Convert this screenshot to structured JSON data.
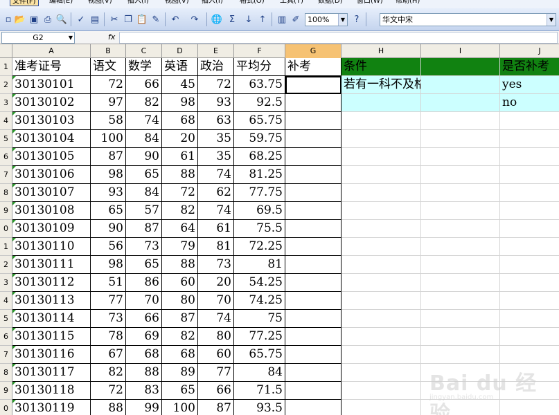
{
  "menu": {
    "items": [
      {
        "label": "文件(F)",
        "active": true
      },
      {
        "label": "编辑(E)"
      },
      {
        "label": "视图(V)"
      },
      {
        "label": "插入(I)"
      },
      {
        "label": "视图(V)"
      },
      {
        "label": "插入(I)"
      },
      {
        "label": "格式(O)"
      },
      {
        "label": "工具(T)"
      },
      {
        "label": "数据(D)"
      },
      {
        "label": "窗口(W)"
      },
      {
        "label": "帮助(H)"
      }
    ]
  },
  "toolbar": {
    "zoom_value": "100%",
    "font_value": "华文中宋",
    "icons": [
      "new-icon",
      "open-icon",
      "save-icon",
      "print-icon",
      "print-preview-icon",
      "spellcheck-icon",
      "research-icon",
      "cut-icon",
      "copy-icon",
      "paste-icon",
      "format-painter-icon",
      "undo-icon",
      "redo-icon",
      "hyperlink-icon",
      "autosum-icon",
      "sort-ascending-icon",
      "sort-descending-icon",
      "chart-icon",
      "drawing-icon",
      "help-icon"
    ]
  },
  "formula_bar": {
    "name_box": "G2",
    "fx_label": "fx",
    "formula": ""
  },
  "columns": [
    "A",
    "B",
    "C",
    "D",
    "E",
    "F",
    "G",
    "H",
    "I",
    "J"
  ],
  "selected_column": "G",
  "table": {
    "headers": [
      "准考证号",
      "语文",
      "数学",
      "英语",
      "政治",
      "平均分",
      "补考"
    ],
    "rows": [
      [
        "30130101",
        "72",
        "66",
        "45",
        "72",
        "63.75",
        ""
      ],
      [
        "30130102",
        "97",
        "82",
        "98",
        "93",
        "92.5",
        ""
      ],
      [
        "30130103",
        "58",
        "74",
        "68",
        "63",
        "65.75",
        ""
      ],
      [
        "30130104",
        "100",
        "84",
        "20",
        "35",
        "59.75",
        ""
      ],
      [
        "30130105",
        "87",
        "90",
        "61",
        "35",
        "68.25",
        ""
      ],
      [
        "30130106",
        "98",
        "65",
        "88",
        "74",
        "81.25",
        ""
      ],
      [
        "30130107",
        "93",
        "84",
        "72",
        "62",
        "77.75",
        ""
      ],
      [
        "30130108",
        "65",
        "57",
        "82",
        "74",
        "69.5",
        ""
      ],
      [
        "30130109",
        "90",
        "87",
        "64",
        "61",
        "75.5",
        ""
      ],
      [
        "30130110",
        "56",
        "73",
        "79",
        "81",
        "72.25",
        ""
      ],
      [
        "30130111",
        "98",
        "65",
        "88",
        "73",
        "81",
        ""
      ],
      [
        "30130112",
        "51",
        "86",
        "60",
        "20",
        "54.25",
        ""
      ],
      [
        "30130113",
        "77",
        "70",
        "80",
        "70",
        "74.25",
        ""
      ],
      [
        "30130114",
        "73",
        "66",
        "87",
        "74",
        "75",
        ""
      ],
      [
        "30130115",
        "78",
        "69",
        "82",
        "80",
        "77.25",
        ""
      ],
      [
        "30130116",
        "67",
        "68",
        "68",
        "60",
        "65.75",
        ""
      ],
      [
        "30130117",
        "82",
        "88",
        "89",
        "77",
        "84",
        ""
      ],
      [
        "30130118",
        "72",
        "83",
        "65",
        "66",
        "71.5",
        ""
      ],
      [
        "30130119",
        "88",
        "99",
        "100",
        "87",
        "93.5",
        ""
      ]
    ]
  },
  "condition_table": {
    "header_condition": "条件",
    "header_result": "是否补考",
    "condition_text": "若有一科不及格",
    "yes": "yes",
    "no": "no"
  },
  "row_numbers": [
    "1",
    "2",
    "3",
    "4",
    "5",
    "6",
    "7",
    "8",
    "9",
    "0",
    "1",
    "2",
    "3",
    "4",
    "5",
    "6",
    "7",
    "8",
    "9",
    "0"
  ],
  "watermark": {
    "text": "Bai du 经验",
    "sub": "jingyan.baidu.com"
  },
  "colors": {
    "header_green": "#118211",
    "cyan_fill": "#ccffff",
    "selected_column": "#f6c273",
    "error_triangle": "#2b9a2b"
  }
}
